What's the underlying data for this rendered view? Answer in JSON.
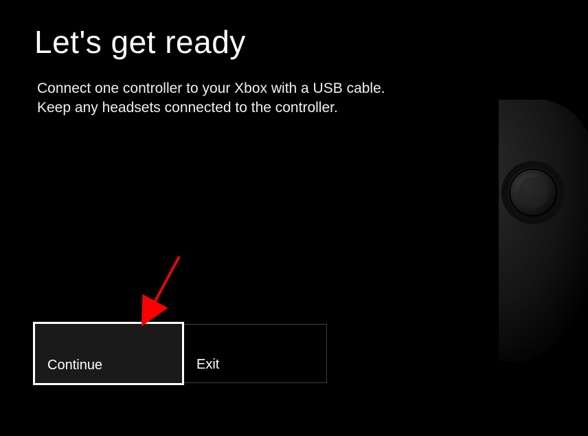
{
  "header": {
    "title": "Let's get ready"
  },
  "body": {
    "instruction": "Connect one controller to your Xbox with a USB cable. Keep any headsets connected to the controller."
  },
  "buttons": {
    "continue_label": "Continue",
    "exit_label": "Exit"
  },
  "annotation": {
    "arrow_color": "#ff0000"
  }
}
